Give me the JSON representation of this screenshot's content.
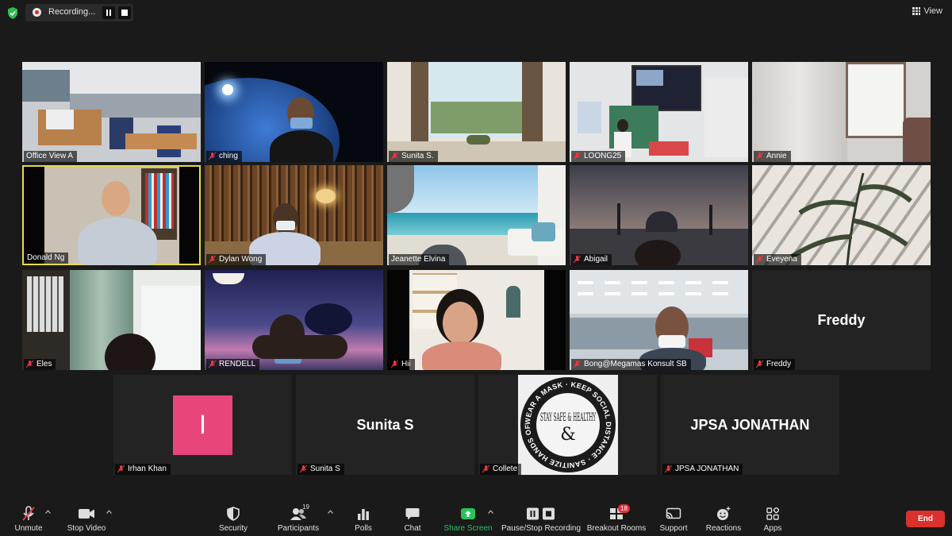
{
  "recording": {
    "label": "Recording..."
  },
  "view": {
    "label": "View"
  },
  "participants": [
    {
      "name": "Office View A"
    },
    {
      "name": "ching"
    },
    {
      "name": "Sunita S."
    },
    {
      "name": "LOONG25"
    },
    {
      "name": "Annie"
    },
    {
      "name": "Donald Ng"
    },
    {
      "name": "Dylan Wong"
    },
    {
      "name": "Jeanette Elvina"
    },
    {
      "name": "Abigail"
    },
    {
      "name": "Eveyena"
    },
    {
      "name": "Eles"
    },
    {
      "name": "RENDELL"
    },
    {
      "name": "Hii"
    },
    {
      "name": "Bong@Megamas Konsult SB"
    },
    {
      "name": "Freddy",
      "display": "Freddy"
    },
    {
      "name": "Irhan Khan",
      "avatar_letter": "I"
    },
    {
      "name": "Sunita S",
      "display": "Sunita S"
    },
    {
      "name": "Collete"
    },
    {
      "name": "JPSA JONATHAN",
      "display": "JPSA JONATHAN"
    }
  ],
  "badge": {
    "text": "STAY SAFE & HEALTHY",
    "ring": "WEAR A MASK · KEEP SOCIAL DISTANCE · SANITIZE HANDS OFTEN"
  },
  "toolbar": {
    "unmute": "Unmute",
    "stop_video": "Stop Video",
    "security": "Security",
    "participants": "Participants",
    "participants_count": "19",
    "polls": "Polls",
    "chat": "Chat",
    "share_screen": "Share Screen",
    "pause_stop_recording": "Pause/Stop Recording",
    "breakout_rooms": "Breakout Rooms",
    "breakout_count": "18",
    "support": "Support",
    "reactions": "Reactions",
    "apps": "Apps",
    "end": "End"
  },
  "colors": {
    "background": "#1a1a1a",
    "tile": "#232323",
    "active_speaker": "#e6dc4a",
    "share_green": "#27c25a",
    "end_red": "#d9312b",
    "avatar_pink": "#e8457a"
  }
}
